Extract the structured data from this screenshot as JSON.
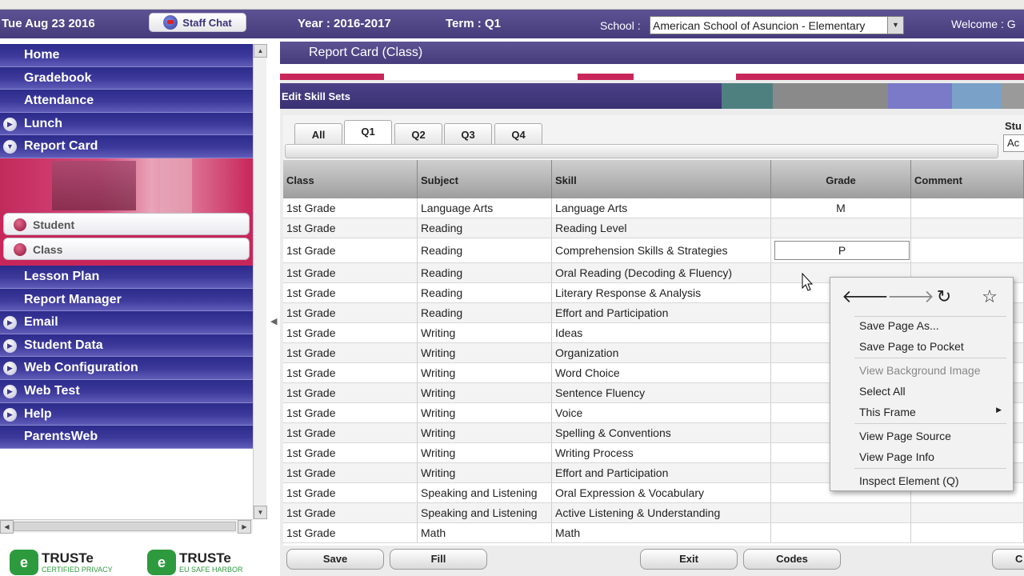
{
  "topbar": {
    "date": "Tue Aug 23 2016",
    "staff_chat": "Staff Chat",
    "year": "Year : 2016-2017",
    "term": "Term : Q1",
    "school_label": "School :",
    "school_value": "American School of Asuncion - Elementary",
    "welcome": "Welcome : G"
  },
  "sidebar": {
    "items_top": [
      "Home",
      "Gradebook",
      "Attendance",
      "Lunch",
      "Report Card"
    ],
    "report_card_sub": [
      "Student",
      "Class"
    ],
    "items_bottom": [
      "Lesson Plan",
      "Report Manager",
      "Email",
      "Student Data",
      "Web Configuration",
      "Web Test",
      "Help",
      "ParentsWeb"
    ],
    "truste": [
      {
        "title": "TRUSTe",
        "sub": "CERTIFIED PRIVACY"
      },
      {
        "title": "TRUSTe",
        "sub": "EU SAFE HARBOR"
      }
    ]
  },
  "main": {
    "report_title": "Report Card (Class)",
    "edit_title": "Edit Skill Sets",
    "tabs": [
      "All",
      "Q1",
      "Q2",
      "Q3",
      "Q4"
    ],
    "active_tab": "Q1",
    "stu_label": "Stu",
    "stu_select": "Ac",
    "columns": [
      "Class",
      "Subject",
      "Skill",
      "Grade",
      "Comment"
    ],
    "rows": [
      {
        "class": "1st Grade",
        "subject": "Language Arts",
        "skill": "Language Arts",
        "grade": "M"
      },
      {
        "class": "1st Grade",
        "subject": "Reading",
        "skill": "Reading Level",
        "grade": ""
      },
      {
        "class": "1st Grade",
        "subject": "Reading",
        "skill": "Comprehension Skills & Strategies",
        "grade": "P"
      },
      {
        "class": "1st Grade",
        "subject": "Reading",
        "skill": "Oral Reading (Decoding & Fluency)",
        "grade": ""
      },
      {
        "class": "1st Grade",
        "subject": "Reading",
        "skill": "Literary Response & Analysis",
        "grade": ""
      },
      {
        "class": "1st Grade",
        "subject": "Reading",
        "skill": "Effort and Participation",
        "grade": ""
      },
      {
        "class": "1st Grade",
        "subject": "Writing",
        "skill": "Ideas",
        "grade": ""
      },
      {
        "class": "1st Grade",
        "subject": "Writing",
        "skill": "Organization",
        "grade": ""
      },
      {
        "class": "1st Grade",
        "subject": "Writing",
        "skill": "Word Choice",
        "grade": ""
      },
      {
        "class": "1st Grade",
        "subject": "Writing",
        "skill": "Sentence Fluency",
        "grade": ""
      },
      {
        "class": "1st Grade",
        "subject": "Writing",
        "skill": "Voice",
        "grade": ""
      },
      {
        "class": "1st Grade",
        "subject": "Writing",
        "skill": "Spelling & Conventions",
        "grade": ""
      },
      {
        "class": "1st Grade",
        "subject": "Writing",
        "skill": "Writing Process",
        "grade": ""
      },
      {
        "class": "1st Grade",
        "subject": "Writing",
        "skill": "Effort and Participation",
        "grade": ""
      },
      {
        "class": "1st Grade",
        "subject": "Speaking and Listening",
        "skill": "Oral Expression & Vocabulary",
        "grade": ""
      },
      {
        "class": "1st Grade",
        "subject": "Speaking and Listening",
        "skill": "Active Listening & Understanding",
        "grade": ""
      },
      {
        "class": "1st Grade",
        "subject": "Math",
        "skill": "Math",
        "grade": ""
      }
    ],
    "buttons": [
      "Save",
      "Fill",
      "Exit",
      "Codes",
      "C"
    ]
  },
  "context_menu": {
    "items": [
      "Save Page As...",
      "Save Page to Pocket",
      "View Background Image",
      "Select All",
      "This Frame",
      "View Page Source",
      "View Page Info",
      "Inspect Element (Q)"
    ],
    "disabled": [
      "View Background Image"
    ]
  },
  "colors": {
    "header_purple": "#463c7b",
    "nav_blue": "#2c2a8a",
    "accent_pink": "#c8265a"
  }
}
